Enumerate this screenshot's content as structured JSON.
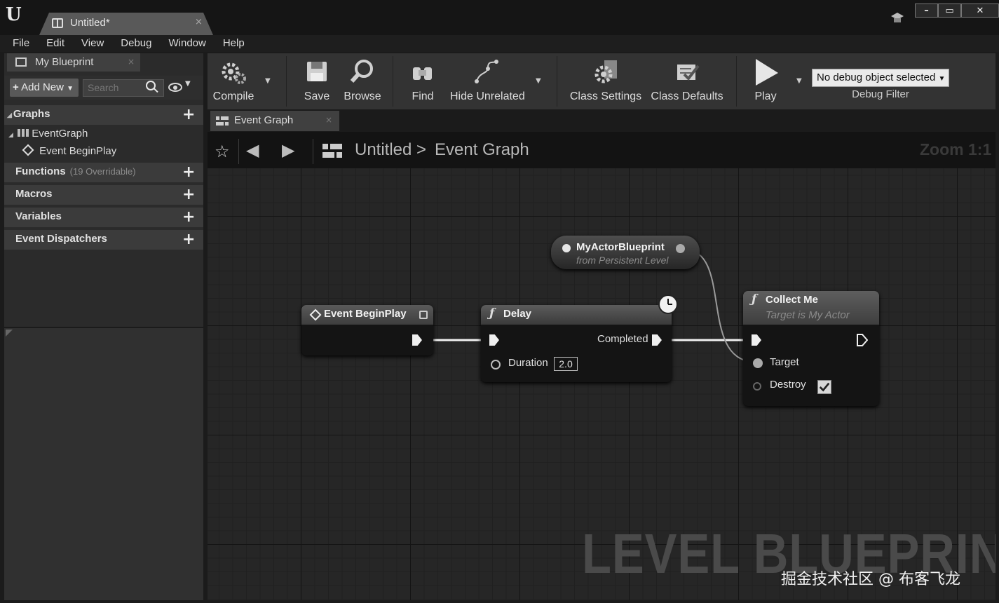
{
  "window": {
    "tab_title": "Untitled*",
    "tab_close": "×",
    "btn_minimize": "–",
    "btn_maximize": "▭",
    "btn_close": "✕"
  },
  "menu": [
    "File",
    "Edit",
    "View",
    "Debug",
    "Window",
    "Help"
  ],
  "my_blueprint": {
    "tab_label": "My Blueprint",
    "tab_close": "×",
    "add_new": "Add New",
    "search_placeholder": "Search",
    "sections": {
      "graphs": "Graphs",
      "event_graph": "EventGraph",
      "event_begin_play": "Event BeginPlay",
      "functions": "Functions",
      "functions_sub": "(19 Overridable)",
      "macros": "Macros",
      "variables": "Variables",
      "event_dispatchers": "Event Dispatchers"
    }
  },
  "toolbar": {
    "compile": "Compile",
    "save": "Save",
    "browse": "Browse",
    "find": "Find",
    "hide_unrelated": "Hide Unrelated",
    "class_settings": "Class Settings",
    "class_defaults": "Class Defaults",
    "play": "Play",
    "debug_object": "No debug object selected",
    "debug_filter": "Debug Filter"
  },
  "graph_tab": {
    "label": "Event Graph",
    "close": "×"
  },
  "breadcrumb": {
    "root": "Untitled",
    "separator": ">",
    "current": "Event Graph",
    "zoom": "Zoom 1:1"
  },
  "nodes": {
    "begin_play": {
      "title": "Event BeginPlay"
    },
    "delay": {
      "title": "Delay",
      "completed": "Completed",
      "duration": "Duration",
      "duration_value": "2.0"
    },
    "actor_ref": {
      "title": "MyActorBlueprint",
      "subtitle": "from Persistent Level"
    },
    "collect_me": {
      "title": "Collect Me",
      "subtitle": "Target is My Actor",
      "target": "Target",
      "destroy": "Destroy",
      "destroy_checked": true
    }
  },
  "watermark": "LEVEL BLUEPRINT",
  "credit": "掘金技术社区 @ 布客飞龙",
  "colors": {
    "exec_wire": "#f0f0f0",
    "object_wire": "#9a9a9a",
    "debug_select_bg": "#eaeaea"
  }
}
